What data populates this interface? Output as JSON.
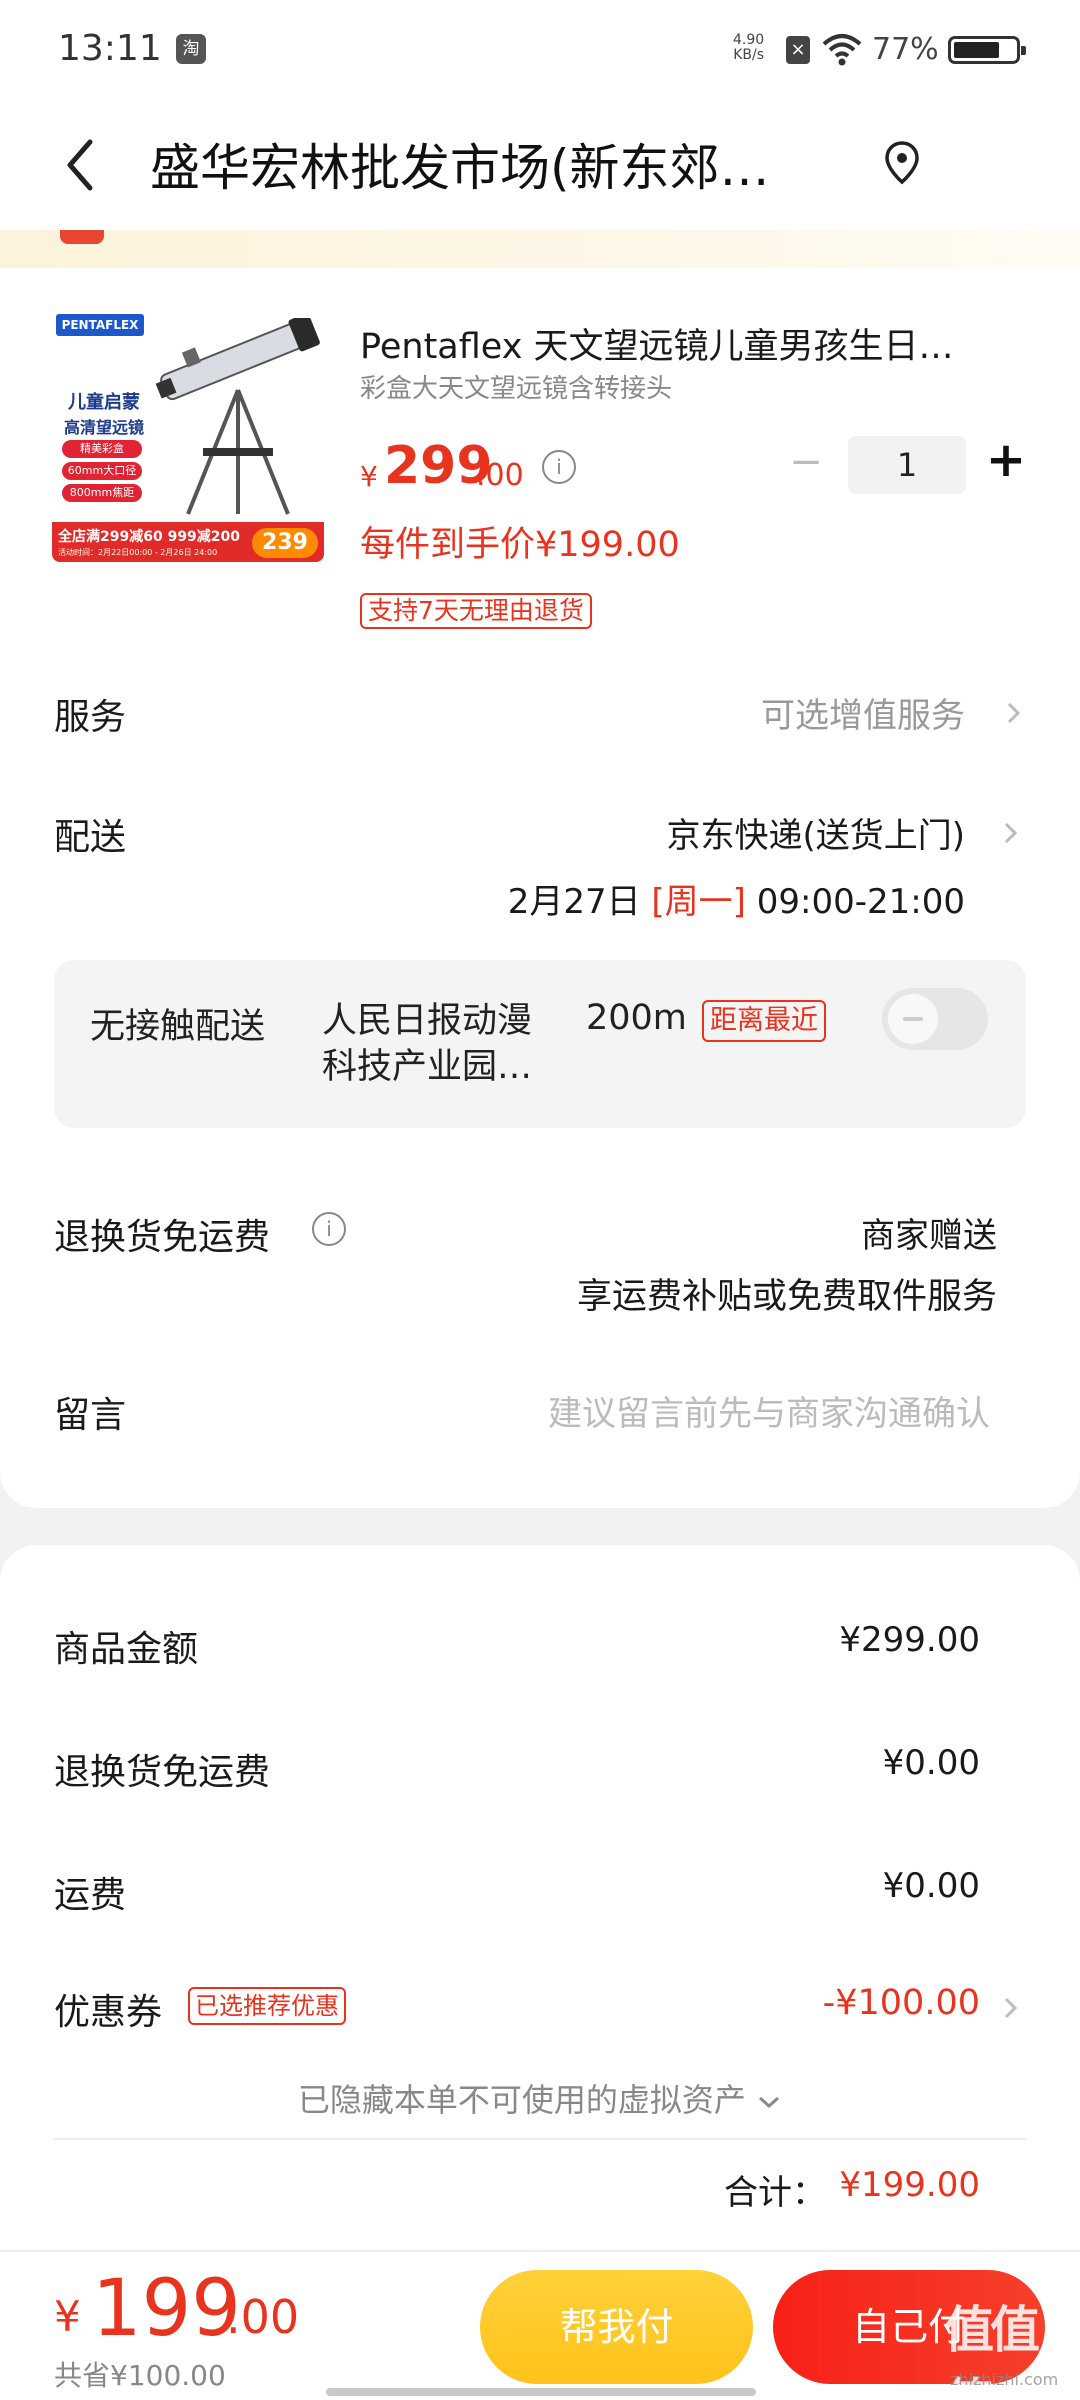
{
  "status_bar": {
    "time": "13:11",
    "app_badge": "淘",
    "network_speed": "4.90",
    "network_unit": "KB/s",
    "battery": "77%",
    "battery_level": 0.77
  },
  "header": {
    "title": "盛华宏林批发市场(新东郊…"
  },
  "product": {
    "image_brand": "PENTAFLEX",
    "image_title_1": "儿童启蒙",
    "image_title_2": "高清望远镜",
    "image_tags": [
      "精美彩盒",
      "60mm大口径",
      "800mm焦距"
    ],
    "image_banner": "全店满299减60 999减200",
    "image_banner_sub": "活动时间：2月22日00:00 - 2月26日 24:00",
    "image_price": "239",
    "title": "Pentaflex 天文望远镜儿童男孩生日…",
    "subtitle": "彩盒大天文望远镜含转接头",
    "price_currency": "¥",
    "price_integer": "299",
    "price_decimal": ".00",
    "quantity": "1",
    "final_price_label": "每件到手价¥199.00",
    "return_policy": "支持7天无理由退货"
  },
  "service": {
    "label": "服务",
    "value": "可选增值服务"
  },
  "delivery": {
    "label": "配送",
    "method": "京东快递(送货上门)",
    "date": "2月27日",
    "weekday": "[周一]",
    "time": "09:00-21:00"
  },
  "contactless": {
    "label": "无接触配送",
    "address": "人民日报动漫科技产业园…",
    "distance": "200m",
    "badge": "距离最近",
    "enabled": false
  },
  "return_fee": {
    "label": "退换货免运费",
    "line1": "商家赠送",
    "line2": "享运费补贴或免费取件服务"
  },
  "note": {
    "label": "留言",
    "placeholder": "建议留言前先与商家沟通确认"
  },
  "summary": {
    "items": [
      {
        "label": "商品金额",
        "value": "¥299.00"
      },
      {
        "label": "退换货免运费",
        "value": "¥0.00"
      },
      {
        "label": "运费",
        "value": "¥0.00"
      }
    ],
    "coupon_label": "优惠券",
    "coupon_badge": "已选推荐优惠",
    "coupon_value": "-¥100.00",
    "hidden_assets": "已隐藏本单不可使用的虚拟资产",
    "total_label": "合计：",
    "total_value": "¥199.00"
  },
  "bottom_bar": {
    "currency": "¥",
    "integer": "199",
    "decimal": ".00",
    "saved": "共省¥100.00",
    "help_pay": "帮我付",
    "self_pay": "自己付",
    "watermark": "值值值",
    "watermark_sub": "zhizhizhi.com"
  },
  "colors": {
    "accent_red": "#e8331f",
    "help_button": "#ffc31a",
    "pay_button": "#f82018"
  }
}
